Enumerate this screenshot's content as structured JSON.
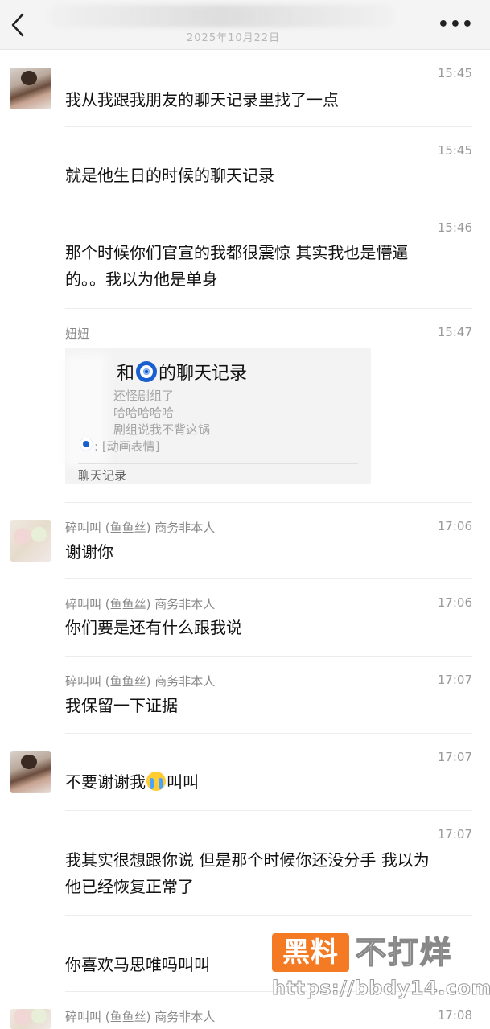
{
  "header": {
    "subtitle_date": "2025年10月22日",
    "more_label": "•••"
  },
  "messages": [
    {
      "time": "15:45",
      "text": "我从我跟我朋友的聊天记录里找了一点"
    },
    {
      "time": "15:45",
      "text": "就是他生日的时候的聊天记录"
    },
    {
      "time": "15:46",
      "text_line1": "那个时候你们官宣的我都很震惊 其实我也是懵逼",
      "text_line2": "的。。我以为他是单身"
    },
    {
      "sender": "妞妞",
      "time": "15:47",
      "card": {
        "title_prefix": "和",
        "title_suffix": "的聊天记录",
        "lines": [
          "还怪剧组了",
          "哈哈哈哈哈",
          "剧组说我不背这锅"
        ],
        "last_line": ": [动画表情]",
        "footer": "聊天记录"
      }
    },
    {
      "sender": "碎叫叫 (鱼鱼丝) 商务非本人",
      "time": "17:06",
      "text": "谢谢你"
    },
    {
      "sender": "碎叫叫 (鱼鱼丝) 商务非本人",
      "time": "17:06",
      "text": "你们要是还有什么跟我说"
    },
    {
      "sender": "碎叫叫 (鱼鱼丝) 商务非本人",
      "time": "17:07",
      "text": "我保留一下证据"
    },
    {
      "time": "17:07",
      "text_before": "不要谢谢我",
      "text_after": "叫叫"
    },
    {
      "time": "17:07",
      "text_line1": "我其实很想跟你说 但是那个时候你还没分手 我以为",
      "text_line2": "他已经恢复正常了"
    },
    {
      "text": "你喜欢马思唯吗叫叫"
    },
    {
      "sender": "碎叫叫 (鱼鱼丝) 商务非本人",
      "time": "17:08"
    }
  ],
  "watermark": {
    "box_text": "黑料",
    "big_text": "不打烊",
    "url": "https://bbdy14.com"
  },
  "icons": {
    "back": "back-arrow-icon",
    "more": "more-dots-icon",
    "eye": "evil-eye-emoji-icon",
    "cry": "crying-face-emoji-icon"
  }
}
